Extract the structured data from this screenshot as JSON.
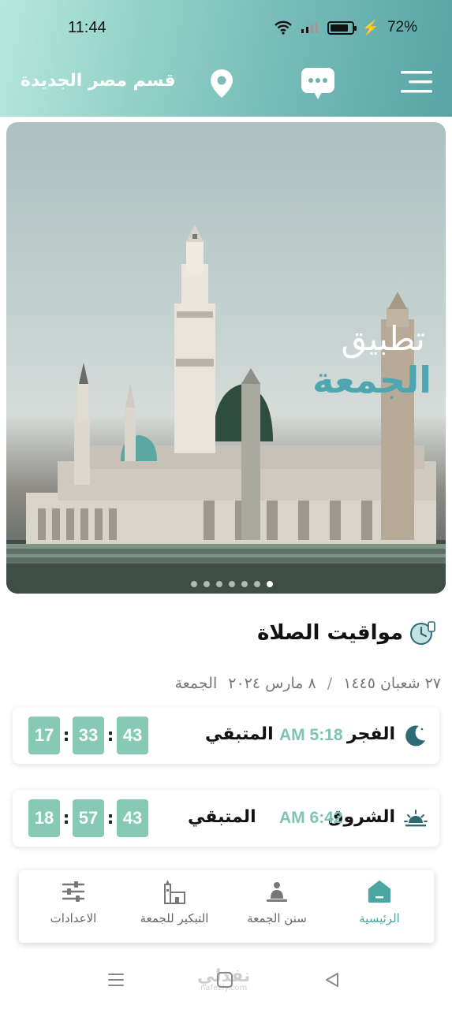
{
  "status_bar": {
    "time": "11:44",
    "battery": "72%"
  },
  "header": {
    "location": "قسم مصر الجديدة"
  },
  "banner": {
    "line1": "تطبيق",
    "line2": "الجمعة",
    "slides": 7,
    "active_slide": 6
  },
  "prayer_section": {
    "title": "مواقيت الصلاة",
    "hijri_date": "٢٧ شعبان ١٤٤٥",
    "separator": "/",
    "gregorian_date": "٨ مارس ٢٠٢٤",
    "weekday": "الجمعة",
    "prayers": [
      {
        "name": "الفجر",
        "time": "AM 5:18",
        "remaining_label": "المتبقي",
        "hours": "43",
        "minutes": "33",
        "seconds": "17",
        "icon": "crescent-moon-icon"
      },
      {
        "name": "الشروق",
        "time": "AM 6:42",
        "remaining_label": "المتبقي",
        "hours": "43",
        "minutes": "57",
        "seconds": "18",
        "icon": "sunrise-icon"
      }
    ]
  },
  "bottom_nav": {
    "items": [
      {
        "label": "الرئيسية",
        "icon": "home-icon",
        "active": true
      },
      {
        "label": "سنن الجمعة",
        "icon": "prayer-person-icon",
        "active": false
      },
      {
        "label": "التبكير للجمعة",
        "icon": "mosque-icon",
        "active": false
      },
      {
        "label": "الاعدادات",
        "icon": "settings-sliders-icon",
        "active": false
      }
    ]
  },
  "watermark": {
    "text": "نفذلي",
    "sub": "nafezly.com"
  },
  "colors": {
    "accent": "#86c9b5",
    "active_nav": "#49a6a1",
    "header_start": "#b7e7dd",
    "header_end": "#5aa4a7"
  }
}
